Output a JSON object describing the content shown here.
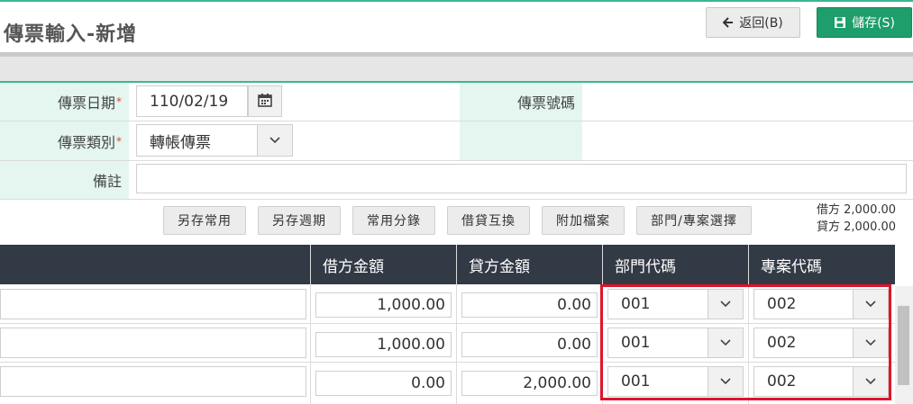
{
  "header": {
    "title": "傳票輸入-新增",
    "back_label": "返回(B)",
    "save_label": "儲存(S)"
  },
  "form": {
    "date_label": "傳票日期",
    "date_value": "110/02/19",
    "voucher_no_label": "傳票號碼",
    "voucher_no_value": "",
    "type_label": "傳票類別",
    "type_value": "轉帳傳票",
    "note_label": "備註",
    "note_value": "",
    "required_mark": "*"
  },
  "toolbar": {
    "buttons": [
      "另存常用",
      "另存週期",
      "常用分錄",
      "借貸互換",
      "附加檔案",
      "部門/專案選擇"
    ]
  },
  "totals": {
    "debit_label": "借方",
    "debit_value": "2,000.00",
    "credit_label": "貸方",
    "credit_value": "2,000.00"
  },
  "table": {
    "columns": [
      "借方金額",
      "貸方金額",
      "部門代碼",
      "專案代碼"
    ],
    "rows": [
      {
        "debit": "1,000.00",
        "credit": "0.00",
        "dept": "001",
        "project": "002"
      },
      {
        "debit": "1,000.00",
        "credit": "0.00",
        "dept": "001",
        "project": "002"
      },
      {
        "debit": "0.00",
        "credit": "2,000.00",
        "dept": "001",
        "project": "002"
      }
    ]
  },
  "colors": {
    "accent": "#3ab795",
    "save_button": "#1e9e6a",
    "header_bg": "#323a45",
    "label_bg": "#e4f6ef",
    "highlight": "#e0142a"
  },
  "icons": {
    "back": "arrow-left-icon",
    "save": "floppy-disk-icon",
    "calendar": "calendar-icon",
    "dropdown": "chevron-down-icon"
  }
}
